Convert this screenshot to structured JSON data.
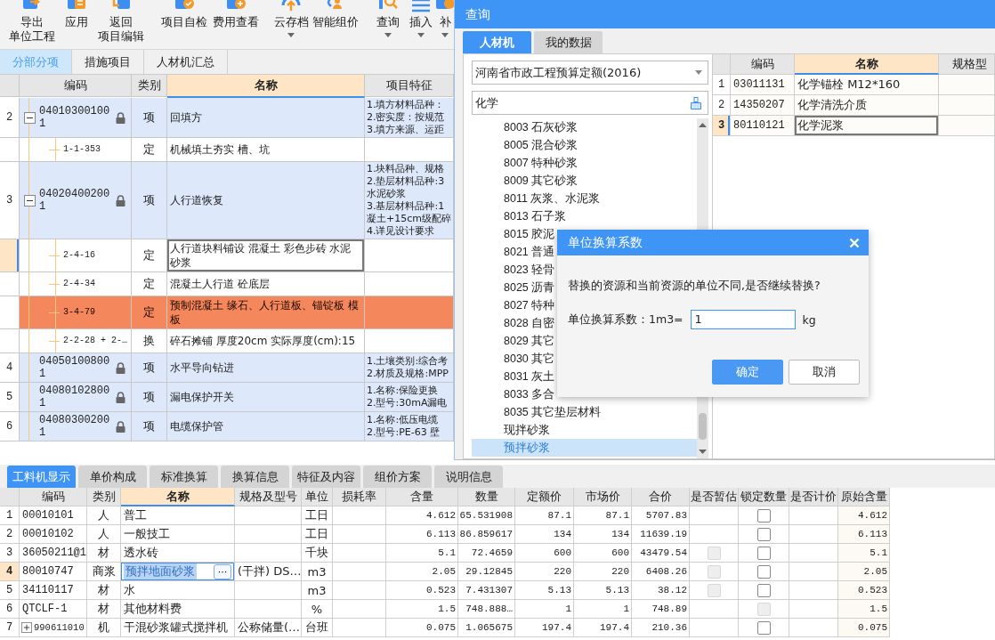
{
  "toolbar": {
    "items": [
      {
        "kind": "export",
        "lines": [
          "导出",
          "单位工程"
        ],
        "dropdown": false
      },
      {
        "kind": "apply",
        "lines": [
          "应用"
        ],
        "dropdown": false
      },
      {
        "kind": "back",
        "lines": [
          "返回",
          "项目编辑"
        ],
        "dropdown": false
      },
      {
        "kind": "check",
        "lines": [
          "项目自检"
        ],
        "dropdown": false
      },
      {
        "kind": "fee",
        "lines": [
          "费用查看"
        ],
        "dropdown": false
      },
      {
        "kind": "cloud",
        "lines": [
          "云存档"
        ],
        "dropdown": true
      },
      {
        "kind": "smart",
        "lines": [
          "智能组价"
        ],
        "dropdown": false
      },
      {
        "kind": "search",
        "lines": [
          "查询"
        ],
        "dropdown": true
      },
      {
        "kind": "insert",
        "lines": [
          "插入"
        ],
        "dropdown": true
      },
      {
        "kind": "supplement",
        "lines": [
          "补"
        ],
        "dropdown": true
      }
    ]
  },
  "upper": {
    "tabs": [
      {
        "label": "分部分项",
        "selected": true
      },
      {
        "label": "措施项目",
        "selected": false
      },
      {
        "label": "人材机汇总",
        "selected": false
      }
    ],
    "columns": [
      {
        "label": "编码",
        "selected": false
      },
      {
        "label": "类别",
        "selected": false
      },
      {
        "label": "名称",
        "selected": true
      },
      {
        "label": "项目特征",
        "selected": false
      }
    ],
    "rows": [
      {
        "num": "2",
        "code": "040103001001",
        "locked": true,
        "type": "项",
        "name": "回填方",
        "features": "1.填方材料品种：\n2.密实度：按规范\n3.填方来源、运距",
        "expanded": true,
        "selected": false,
        "flagged": false,
        "children": [
          {
            "code": "1-1-353",
            "type": "定",
            "name": "机械填土夯实 槽、坑",
            "selected": false,
            "flagged": false
          }
        ]
      },
      {
        "num": "3",
        "code": "040204002001",
        "locked": true,
        "type": "项",
        "name": "人行道恢复",
        "features": "1.块料品种、规格\n2.垫层材料品种:3\n水泥砂浆\n3.基层材料品种:1\n凝土+15cm级配碎\n4.详见设计要求",
        "expanded": true,
        "selected": false,
        "flagged": false,
        "children": [
          {
            "code": "2-4-16",
            "type": "定",
            "name": "人行道块料铺设 混凝土 彩色步砖 水泥砂浆",
            "selected": true,
            "flagged": false
          },
          {
            "code": "2-4-34",
            "type": "定",
            "name": "混凝土人行道 砼底层",
            "selected": false,
            "flagged": false
          },
          {
            "code": "3-4-79",
            "type": "定",
            "name": "预制混凝土 缘石、人行道板、锚锭板 模板",
            "selected": false,
            "flagged": true
          },
          {
            "code": "2-2-28 + 2-…",
            "type": "换",
            "name": "碎石摊铺 厚度20cm  实际厚度(cm):15",
            "selected": false,
            "flagged": false
          }
        ]
      },
      {
        "num": "4",
        "code": "040501008001",
        "locked": true,
        "type": "项",
        "name": "水平导向钻进",
        "features": "1.土壤类别:综合考\n2.材质及规格:MPP",
        "selected": false,
        "flagged": false
      },
      {
        "num": "5",
        "code": "040801028001",
        "locked": true,
        "type": "项",
        "name": "漏电保护开关",
        "features": "1.名称:保险更换\n2.型号:30mA漏电",
        "selected": false,
        "flagged": false
      },
      {
        "num": "6",
        "code": "040803002001",
        "locked": true,
        "type": "项",
        "name": "电缆保护管",
        "features": "1.名称:低压电缆\n2.型号:PE-63 壁",
        "selected": false,
        "flagged": false
      }
    ]
  },
  "detail": {
    "tabs": [
      {
        "label": "工料机显示",
        "selected": true
      },
      {
        "label": "单价构成",
        "selected": false
      },
      {
        "label": "标准换算",
        "selected": false
      },
      {
        "label": "换算信息",
        "selected": false
      },
      {
        "label": "特征及内容",
        "selected": false
      },
      {
        "label": "组价方案",
        "selected": false
      },
      {
        "label": "说明信息",
        "selected": false
      }
    ],
    "columns": [
      {
        "label": "编码",
        "selected": false
      },
      {
        "label": "类别",
        "selected": false
      },
      {
        "label": "名称",
        "selected": true
      },
      {
        "label": "规格及型号",
        "selected": false
      },
      {
        "label": "单位",
        "selected": false
      },
      {
        "label": "损耗率",
        "selected": false
      },
      {
        "label": "含量",
        "selected": false
      },
      {
        "label": "数量",
        "selected": false
      },
      {
        "label": "定额价",
        "selected": false
      },
      {
        "label": "市场价",
        "selected": false
      },
      {
        "label": "合价",
        "selected": false
      },
      {
        "label": "是否暂估",
        "selected": false
      },
      {
        "label": "锁定数量",
        "selected": false
      },
      {
        "label": "是否计价",
        "selected": false
      },
      {
        "label": "原始含量",
        "selected": false
      }
    ],
    "rows": [
      {
        "num": "1",
        "code": "00010101",
        "type": "人",
        "name": "普工",
        "unit": "工日",
        "content": "4.612",
        "qty": "65.531908",
        "quota_price": "87.1",
        "market_price": "87.1",
        "total": "5707.83",
        "lock_qty": {
          "checked": false,
          "disabled": false
        },
        "original": "4.612",
        "selected": false,
        "editing": false
      },
      {
        "num": "2",
        "code": "00010102",
        "type": "人",
        "name": "一般技工",
        "unit": "工日",
        "content": "6.113",
        "qty": "86.859617",
        "quota_price": "134",
        "market_price": "134",
        "total": "11639.19",
        "lock_qty": {
          "checked": false,
          "disabled": false
        },
        "original": "6.113",
        "selected": false,
        "editing": false
      },
      {
        "num": "3",
        "code": "36050211@1",
        "type": "材",
        "name": "透水砖",
        "unit": "千块",
        "content": "5.1",
        "qty": "72.4659",
        "quota_price": "600",
        "market_price": "600",
        "total": "43479.54",
        "provisional": {
          "checked": false,
          "disabled": true
        },
        "lock_qty": {
          "checked": false,
          "disabled": false
        },
        "original": "5.1",
        "selected": false,
        "editing": false
      },
      {
        "num": "4",
        "code": "80010747",
        "type": "商浆",
        "name": "预拌地面砂浆",
        "edit_button": "···",
        "spec": "(干拌) DS…",
        "unit": "m3",
        "content": "2.05",
        "qty": "29.12845",
        "quota_price": "220",
        "market_price": "220",
        "total": "6408.26",
        "provisional": {
          "checked": false,
          "disabled": true
        },
        "lock_qty": {
          "checked": false,
          "disabled": false
        },
        "original": "2.05",
        "selected": true,
        "editing": true
      },
      {
        "num": "5",
        "code": "34110117",
        "type": "材",
        "name": "水",
        "unit": "m3",
        "content": "0.523",
        "qty": "7.431307",
        "quota_price": "5.13",
        "market_price": "5.13",
        "total": "38.12",
        "provisional": {
          "checked": false,
          "disabled": true
        },
        "lock_qty": {
          "checked": false,
          "disabled": false
        },
        "original": "0.523",
        "selected": false,
        "editing": false
      },
      {
        "num": "6",
        "code": "QTCLF-1",
        "type": "材",
        "name": "其他材料费",
        "unit": "%",
        "content": "1.5",
        "qty": "748.888…",
        "quota_price": "1",
        "market_price": "1",
        "total": "748.89",
        "lock_qty": {
          "checked": false,
          "disabled": true
        },
        "original": "1.5",
        "selected": false,
        "editing": false
      },
      {
        "num": "7",
        "code": "990611010",
        "expanded": false,
        "type": "机",
        "name": "干混砂浆罐式搅拌机",
        "spec": "公称储量(…",
        "unit": "台班",
        "content": "0.075",
        "qty": "1.065675",
        "quota_price": "197.4",
        "market_price": "197.4",
        "total": "210.36",
        "lock_qty": {
          "checked": false,
          "disabled": false
        },
        "original": "0.075",
        "selected": false,
        "editing": false
      }
    ]
  },
  "query": {
    "title": "查询",
    "tabs": [
      {
        "label": "人材机",
        "selected": true
      },
      {
        "label": "我的数据",
        "selected": false
      }
    ],
    "library": "河南省市政工程预算定额(2016)",
    "search": "化学",
    "categories": [
      {
        "label": "8003 石灰砂浆",
        "selected": false
      },
      {
        "label": "8005 混合砂浆",
        "selected": false
      },
      {
        "label": "8007 特种砂浆",
        "selected": false
      },
      {
        "label": "8009 其它砂浆",
        "selected": false
      },
      {
        "label": "8011 灰浆、水泥浆",
        "selected": false
      },
      {
        "label": "8013 石子浆",
        "selected": false
      },
      {
        "label": "8015 胶泥",
        "selected": false
      },
      {
        "label": "8021 普通",
        "selected": false
      },
      {
        "label": "8023 轻骨",
        "selected": false
      },
      {
        "label": "8025 沥青",
        "selected": false
      },
      {
        "label": "8027 特种",
        "selected": false
      },
      {
        "label": "8028 自密",
        "selected": false
      },
      {
        "label": "8029 其它",
        "selected": false
      },
      {
        "label": "8030 其它",
        "selected": false
      },
      {
        "label": "8031 灰土",
        "selected": false
      },
      {
        "label": "8033 多合",
        "selected": false
      },
      {
        "label": "8035 其它垫层材料",
        "selected": false
      },
      {
        "label": "现拌砂浆",
        "selected": false
      },
      {
        "label": "预拌砂浆",
        "selected": true
      }
    ],
    "columns": [
      {
        "label": "编码",
        "selected": false
      },
      {
        "label": "名称",
        "selected": true
      },
      {
        "label": "规格型",
        "selected": false
      }
    ],
    "results": [
      {
        "num": "1",
        "code": "03011131",
        "name": "化学锚栓 M12*160",
        "selected": false
      },
      {
        "num": "2",
        "code": "14350207",
        "name": "化学清洗介质",
        "selected": false
      },
      {
        "num": "3",
        "code": "80110121",
        "name": "化学泥浆",
        "selected": true
      }
    ]
  },
  "dialog": {
    "title": "单位换算系数",
    "message": "替换的资源和当前资源的单位不同,是否继续替换?",
    "label": "单位换算系数：1m3=",
    "value": "1",
    "unit": "kg",
    "buttons": [
      {
        "label": "确定",
        "kind": "primary"
      },
      {
        "label": "取消",
        "kind": "secondary"
      }
    ]
  }
}
